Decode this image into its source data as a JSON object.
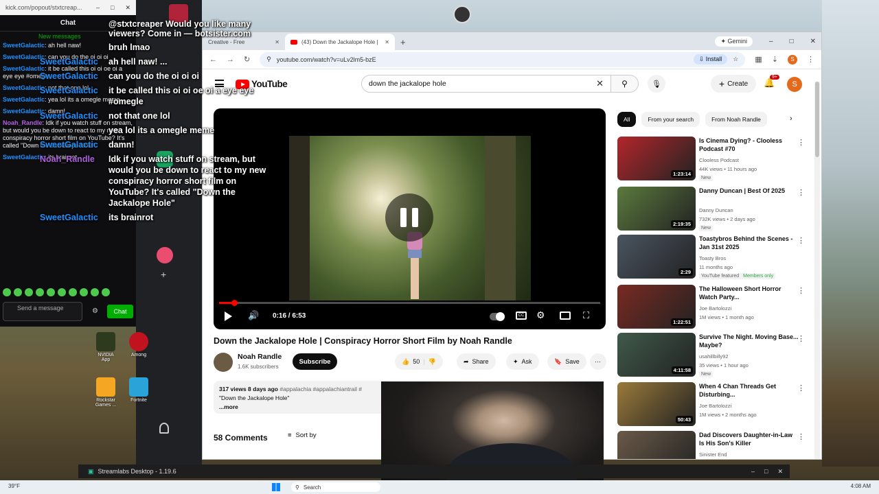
{
  "chat_popout": {
    "url": "kick.com/popout/stxtcreap...",
    "header": "Chat",
    "new_messages": "New messages",
    "lines": [
      {
        "user": "SweetGalactic",
        "msg": "ah hell naw!"
      },
      {
        "user": "SweetGalactic",
        "msg": "can you do the oi oi oi"
      },
      {
        "user": "SweetGalactic",
        "msg": "it be called this oi oi oe oi a eye eye #omegle"
      },
      {
        "user": "SweetGalactic",
        "msg": "not that one lol"
      },
      {
        "user": "SweetGalactic",
        "msg": "yea lol its a omegle meme"
      },
      {
        "user": "SweetGalactic",
        "msg": "damn!"
      },
      {
        "user": "Noah_Randle",
        "msg": "Idk if you watch stuff on stream, but would you be down to react to my new conspiracy horror short film on YouTube? It's called \"Down the Jackalope Hole\""
      },
      {
        "user": "SweetGalactic",
        "msg": "its brainrot"
      }
    ],
    "send_placeholder": "Send a message",
    "chat_button": "Chat"
  },
  "overlay": {
    "top_line": "@stxtcreaper Would you like many viewers? Come in — botsister.com",
    "lines": [
      {
        "user": "",
        "msg": "bruh lmao"
      },
      {
        "user": "SweetGalactic",
        "msg": "ah hell naw! ..."
      },
      {
        "user": "SweetGalactic",
        "msg": "can you do the oi oi oi"
      },
      {
        "user": "SweetGalactic",
        "msg": "it be called this oi oi oe oi a eye eye #omegle"
      },
      {
        "user": "SweetGalactic",
        "msg": "not that one lol"
      },
      {
        "user": "",
        "msg": "yea lol its a omegle meme"
      },
      {
        "user": "SweetGalactic",
        "msg": "damn!"
      },
      {
        "user": "Noah_Randle",
        "msg": "Idk if you watch stuff on stream, but would you be down to react to my new conspiracy horror short film on YouTube? It's called \"Down the Jackalope Hole\""
      },
      {
        "user": "SweetGalactic",
        "msg": "its brainrot"
      }
    ]
  },
  "browser": {
    "tabs": [
      {
        "label": "Creative - Free"
      },
      {
        "label": "(43) Down the Jackalope Hole |"
      }
    ],
    "gemini": "Gemini",
    "url": "youtube.com/watch?v=uLv2lm5-bzE",
    "install": "Install",
    "profile_letter": "S"
  },
  "youtube": {
    "logo": "YouTube",
    "search_value": "down the jackalope hole",
    "create": "Create",
    "notif_count": "9+",
    "avatar_letter": "S"
  },
  "player": {
    "time": "0:16 / 6:53",
    "progress_fraction": 0.039
  },
  "video": {
    "title": "Down the Jackalope Hole | Conspiracy Horror Short Film by Noah Randle",
    "channel": "Noah Randle",
    "subscribers": "1.6K subscribers",
    "subscribe": "Subscribe",
    "likes": "50",
    "share": "Share",
    "ask": "Ask",
    "save": "Save",
    "views_line": "317 views  8 days ago",
    "tags": "#appalachia #appalachiantrail #",
    "desc_line": "\"Down the Jackalope Hole\"",
    "more": "...more",
    "comments_count": "58 Comments",
    "sort_by": "Sort by"
  },
  "chips": [
    "All",
    "From your search",
    "From Noah Randle"
  ],
  "recommendations": [
    {
      "title": "Is Cinema Dying? - Clooless Podcast #70",
      "channel": "Clooless Podcast",
      "meta": "44K views • 11 hours ago",
      "badge": "New",
      "duration": "1:23:14",
      "color": "#b3262b"
    },
    {
      "title": "Danny Duncan | Best Of 2025",
      "channel": "Danny Duncan",
      "meta": "732K views • 2 days ago",
      "badge": "New",
      "duration": "2:19:35",
      "color": "#5b7a3e"
    },
    {
      "title": "Toastybros Behind the Scenes - Jan 31st 2025",
      "channel": "Toasty Bros",
      "meta": "11 months ago",
      "badge": "YouTube featured",
      "members": "Members only",
      "duration": "2:29",
      "color": "#4a5561"
    },
    {
      "title": "The Halloween Short Horror Watch Party...",
      "channel": "Joe Bartolozzi",
      "meta": "1M views • 1 month ago",
      "badge": "",
      "duration": "1:22:51",
      "color": "#7a2a22"
    },
    {
      "title": "Survive The Night. Moving Base... Maybe?",
      "channel": "usahillbilly92",
      "meta": "35 views • 1 hour ago",
      "badge": "New",
      "duration": "4:11:58",
      "color": "#3f5a4a"
    },
    {
      "title": "When 4 Chan Threads Get Disturbing...",
      "channel": "Joe Bartolozzi",
      "meta": "1M views • 2 months ago",
      "badge": "",
      "duration": "50:43",
      "color": "#9a7a3a"
    },
    {
      "title": "Dad Discovers Daughter-in-Law Is His Son's Killer",
      "channel": "Sinister End",
      "meta": "",
      "badge": "",
      "duration": "",
      "color": "#6a5a48"
    }
  ],
  "streamlabs": {
    "title": "Streamlabs Desktop - 1.19.6"
  },
  "taskbar": {
    "weather": "39°F",
    "search": "Search",
    "clock": "4:08 AM"
  },
  "desktop_icons": [
    {
      "label": "NVIDIA App"
    },
    {
      "label": "Among"
    },
    {
      "label": "Rockstar Games ..."
    },
    {
      "label": "Fortnite"
    }
  ]
}
